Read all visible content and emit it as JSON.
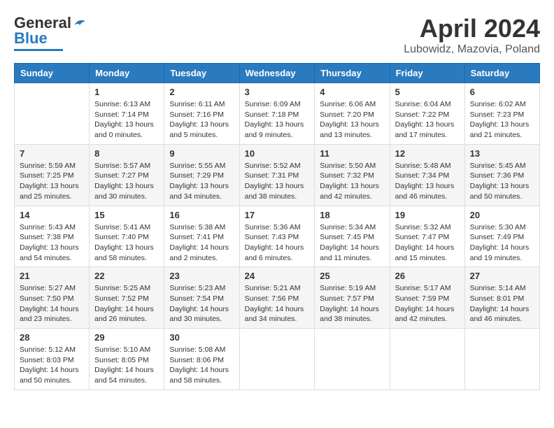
{
  "header": {
    "logo_general": "General",
    "logo_blue": "Blue",
    "month_title": "April 2024",
    "location": "Lubowidz, Mazovia, Poland"
  },
  "days_of_week": [
    "Sunday",
    "Monday",
    "Tuesday",
    "Wednesday",
    "Thursday",
    "Friday",
    "Saturday"
  ],
  "weeks": [
    [
      {
        "day": "",
        "info": ""
      },
      {
        "day": "1",
        "info": "Sunrise: 6:13 AM\nSunset: 7:14 PM\nDaylight: 13 hours\nand 0 minutes."
      },
      {
        "day": "2",
        "info": "Sunrise: 6:11 AM\nSunset: 7:16 PM\nDaylight: 13 hours\nand 5 minutes."
      },
      {
        "day": "3",
        "info": "Sunrise: 6:09 AM\nSunset: 7:18 PM\nDaylight: 13 hours\nand 9 minutes."
      },
      {
        "day": "4",
        "info": "Sunrise: 6:06 AM\nSunset: 7:20 PM\nDaylight: 13 hours\nand 13 minutes."
      },
      {
        "day": "5",
        "info": "Sunrise: 6:04 AM\nSunset: 7:22 PM\nDaylight: 13 hours\nand 17 minutes."
      },
      {
        "day": "6",
        "info": "Sunrise: 6:02 AM\nSunset: 7:23 PM\nDaylight: 13 hours\nand 21 minutes."
      }
    ],
    [
      {
        "day": "7",
        "info": "Sunrise: 5:59 AM\nSunset: 7:25 PM\nDaylight: 13 hours\nand 25 minutes."
      },
      {
        "day": "8",
        "info": "Sunrise: 5:57 AM\nSunset: 7:27 PM\nDaylight: 13 hours\nand 30 minutes."
      },
      {
        "day": "9",
        "info": "Sunrise: 5:55 AM\nSunset: 7:29 PM\nDaylight: 13 hours\nand 34 minutes."
      },
      {
        "day": "10",
        "info": "Sunrise: 5:52 AM\nSunset: 7:31 PM\nDaylight: 13 hours\nand 38 minutes."
      },
      {
        "day": "11",
        "info": "Sunrise: 5:50 AM\nSunset: 7:32 PM\nDaylight: 13 hours\nand 42 minutes."
      },
      {
        "day": "12",
        "info": "Sunrise: 5:48 AM\nSunset: 7:34 PM\nDaylight: 13 hours\nand 46 minutes."
      },
      {
        "day": "13",
        "info": "Sunrise: 5:45 AM\nSunset: 7:36 PM\nDaylight: 13 hours\nand 50 minutes."
      }
    ],
    [
      {
        "day": "14",
        "info": "Sunrise: 5:43 AM\nSunset: 7:38 PM\nDaylight: 13 hours\nand 54 minutes."
      },
      {
        "day": "15",
        "info": "Sunrise: 5:41 AM\nSunset: 7:40 PM\nDaylight: 13 hours\nand 58 minutes."
      },
      {
        "day": "16",
        "info": "Sunrise: 5:38 AM\nSunset: 7:41 PM\nDaylight: 14 hours\nand 2 minutes."
      },
      {
        "day": "17",
        "info": "Sunrise: 5:36 AM\nSunset: 7:43 PM\nDaylight: 14 hours\nand 6 minutes."
      },
      {
        "day": "18",
        "info": "Sunrise: 5:34 AM\nSunset: 7:45 PM\nDaylight: 14 hours\nand 11 minutes."
      },
      {
        "day": "19",
        "info": "Sunrise: 5:32 AM\nSunset: 7:47 PM\nDaylight: 14 hours\nand 15 minutes."
      },
      {
        "day": "20",
        "info": "Sunrise: 5:30 AM\nSunset: 7:49 PM\nDaylight: 14 hours\nand 19 minutes."
      }
    ],
    [
      {
        "day": "21",
        "info": "Sunrise: 5:27 AM\nSunset: 7:50 PM\nDaylight: 14 hours\nand 23 minutes."
      },
      {
        "day": "22",
        "info": "Sunrise: 5:25 AM\nSunset: 7:52 PM\nDaylight: 14 hours\nand 26 minutes."
      },
      {
        "day": "23",
        "info": "Sunrise: 5:23 AM\nSunset: 7:54 PM\nDaylight: 14 hours\nand 30 minutes."
      },
      {
        "day": "24",
        "info": "Sunrise: 5:21 AM\nSunset: 7:56 PM\nDaylight: 14 hours\nand 34 minutes."
      },
      {
        "day": "25",
        "info": "Sunrise: 5:19 AM\nSunset: 7:57 PM\nDaylight: 14 hours\nand 38 minutes."
      },
      {
        "day": "26",
        "info": "Sunrise: 5:17 AM\nSunset: 7:59 PM\nDaylight: 14 hours\nand 42 minutes."
      },
      {
        "day": "27",
        "info": "Sunrise: 5:14 AM\nSunset: 8:01 PM\nDaylight: 14 hours\nand 46 minutes."
      }
    ],
    [
      {
        "day": "28",
        "info": "Sunrise: 5:12 AM\nSunset: 8:03 PM\nDaylight: 14 hours\nand 50 minutes."
      },
      {
        "day": "29",
        "info": "Sunrise: 5:10 AM\nSunset: 8:05 PM\nDaylight: 14 hours\nand 54 minutes."
      },
      {
        "day": "30",
        "info": "Sunrise: 5:08 AM\nSunset: 8:06 PM\nDaylight: 14 hours\nand 58 minutes."
      },
      {
        "day": "",
        "info": ""
      },
      {
        "day": "",
        "info": ""
      },
      {
        "day": "",
        "info": ""
      },
      {
        "day": "",
        "info": ""
      }
    ]
  ]
}
